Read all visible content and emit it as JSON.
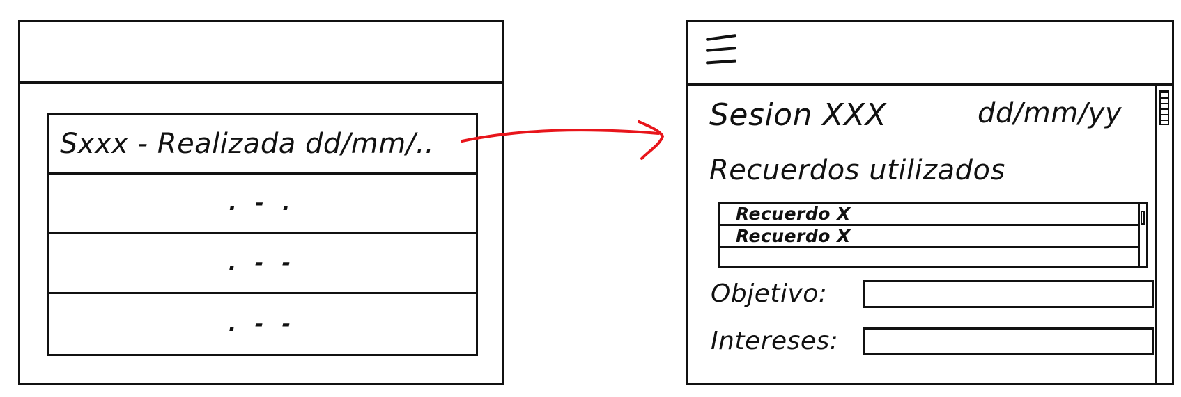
{
  "left_screen": {
    "sessions": [
      {
        "label": "Sxxx - Realizada dd/mm/.."
      },
      {
        "label": ". - ."
      },
      {
        "label": ". - -"
      },
      {
        "label": ". - -"
      }
    ]
  },
  "arrow": {
    "color": "#e8151b"
  },
  "right_screen": {
    "menu_icon": "hamburger-icon",
    "session_title": "Sesion XXX",
    "session_date": "dd/mm/yy",
    "memories_heading": "Recuerdos utilizados",
    "memories": [
      {
        "label": "Recuerdo X"
      },
      {
        "label": "Recuerdo X"
      },
      {
        "label": ""
      }
    ],
    "fields": {
      "objective_label": "Objetivo:",
      "interests_label": "Intereses:"
    }
  }
}
